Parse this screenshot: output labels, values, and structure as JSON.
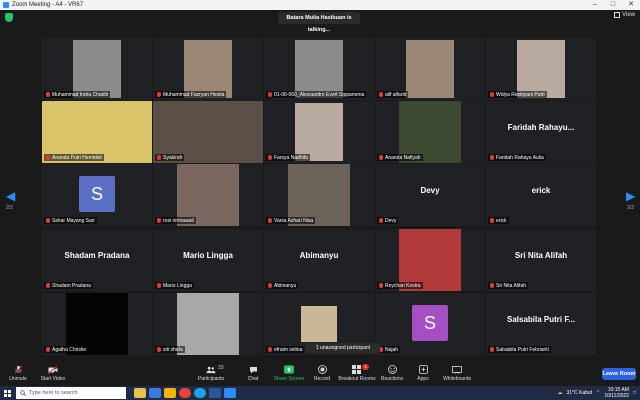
{
  "window": {
    "title": "Zoom Meeting - A4 - VR67"
  },
  "topbar": {
    "talking": "Batara Mulia Hasibuan is talking...",
    "view_label": "View"
  },
  "pagination": {
    "left": "2/2",
    "right": "2/2"
  },
  "tiles": [
    {
      "name": "Muhammad Indra Chaidir",
      "big": "",
      "video": "grey"
    },
    {
      "name": "Muhammad Fazryan Hestia",
      "big": "",
      "video": "face"
    },
    {
      "name": "01-06-060_Alessandro Evert Sippamena",
      "big": "",
      "video": "grey"
    },
    {
      "name": "alif alfarid",
      "big": "",
      "video": "face"
    },
    {
      "name": "Widya Rezkiyani Putri",
      "big": "",
      "video": "hijab"
    },
    {
      "name": "Ananda Putri Hemidah",
      "big": "",
      "video": "hijab-yellow"
    },
    {
      "name": "Syakirah",
      "big": "",
      "video": "hijab-dark"
    },
    {
      "name": "Farsya Nadhifa",
      "big": "",
      "video": "hijab"
    },
    {
      "name": "Ananda Nafiyah",
      "big": "",
      "video": "night"
    },
    {
      "name": "Faridah Rahayu Aulia",
      "big": "Faridah Rahayu...",
      "video": ""
    },
    {
      "name": "Sekar Mayang Sari",
      "big": "",
      "video": "avatar-s-blue"
    },
    {
      "name": "rosi nirmawati",
      "big": "",
      "video": "face-girl"
    },
    {
      "name": "Vania Azhari Nisa",
      "big": "",
      "video": "room"
    },
    {
      "name": "Devy",
      "big": "Devy",
      "video": ""
    },
    {
      "name": "erick",
      "big": "erick",
      "video": ""
    },
    {
      "name": "Shadam Pradana",
      "big": "Shadam Pradana",
      "video": ""
    },
    {
      "name": "Mario Lingga",
      "big": "Mario Lingga",
      "video": ""
    },
    {
      "name": "Abimanyu",
      "big": "Abimanyu",
      "video": ""
    },
    {
      "name": "Reychan Kostra",
      "big": "",
      "video": "rider"
    },
    {
      "name": "Sri Nita Alifah",
      "big": "Sri Nita Alifah",
      "video": ""
    },
    {
      "name": "Agatha Christie",
      "big": "",
      "video": "black"
    },
    {
      "name": "siti shafa",
      "big": "",
      "video": "grey-light"
    },
    {
      "name": "efraim selina",
      "big": "",
      "video": "small-photo"
    },
    {
      "name": "Najah",
      "big": "",
      "video": "avatar-s-purple"
    },
    {
      "name": "Salsabila Putri Febrianti",
      "big": "Salsabila Putri F...",
      "video": ""
    }
  ],
  "unassigned": "1 unassigned participant",
  "avatar_letter": "S",
  "toolbar": {
    "unmute": "Unmute",
    "start_video": "Start Video",
    "participants": "Participants",
    "participants_count": "33",
    "chat": "Chat",
    "share_screen": "Share Screen",
    "record": "Record",
    "breakout": "Breakout Rooms",
    "breakout_badge": "1",
    "reactions": "Reactions",
    "apps": "Apps",
    "whiteboards": "Whiteboards",
    "leave": "Leave Room"
  },
  "taskbar": {
    "search_placeholder": "Type here to search",
    "weather": "31°C Kabut",
    "time": "10:15 AM",
    "date": "10/11/2022"
  },
  "colors": {
    "accent": "#2d8cff",
    "share_green": "#23c26b",
    "leave_blue": "#2d63e0",
    "mic_red": "#e03a3a"
  }
}
